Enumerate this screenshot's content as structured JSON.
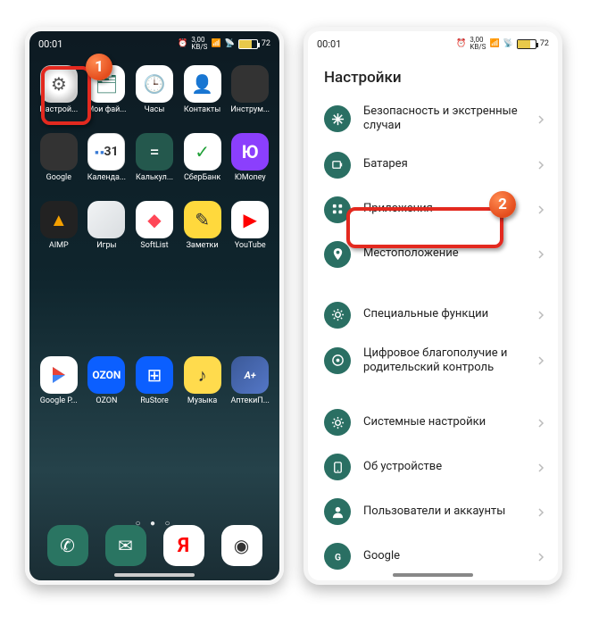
{
  "status": {
    "time": "00:01",
    "speed": "3,00",
    "speed_unit": "KB/S",
    "battery": "72"
  },
  "home": {
    "rows": [
      [
        {
          "label": "Настрой...",
          "icon": "ic-settings",
          "glyph": "⚙"
        },
        {
          "label": "Мои фай...",
          "icon": "ic-files",
          "glyph": "🗂"
        },
        {
          "label": "Часы",
          "icon": "ic-clock",
          "glyph": "🕒"
        },
        {
          "label": "Контакты",
          "icon": "ic-contacts",
          "glyph": "👤"
        },
        {
          "label": "Инструм...",
          "icon": "ic-tools",
          "folder": true
        }
      ],
      [
        {
          "label": "Google",
          "icon": "ic-google",
          "folder": true
        },
        {
          "label": "Календа...",
          "icon": "ic-calendar",
          "calendar": "31"
        },
        {
          "label": "Калькул...",
          "icon": "ic-calc",
          "glyph": "="
        },
        {
          "label": "СберБанк",
          "icon": "ic-sber",
          "glyph": "✓"
        },
        {
          "label": "ЮMoney",
          "icon": "ic-yoo",
          "glyph": "Ю"
        }
      ],
      [
        {
          "label": "AIMP",
          "icon": "ic-aimp",
          "glyph": "▲"
        },
        {
          "label": "Игры",
          "icon": "ic-games",
          "folder": true
        },
        {
          "label": "SoftList",
          "icon": "ic-softlist",
          "glyph": "◆"
        },
        {
          "label": "Заметки",
          "icon": "ic-notes",
          "glyph": "✎"
        },
        {
          "label": "YouTube",
          "icon": "ic-youtube",
          "glyph": "▶"
        }
      ]
    ],
    "favs": [
      {
        "label": "Google P...",
        "icon": "ic-play"
      },
      {
        "label": "OZON",
        "icon": "ic-ozon",
        "glyph": "OZON"
      },
      {
        "label": "RuStore",
        "icon": "ic-rustore",
        "glyph": "⊞"
      },
      {
        "label": "Музыка",
        "icon": "ic-music",
        "glyph": "♪"
      },
      {
        "label": "АптекиП...",
        "icon": "ic-apteka",
        "glyph": "A+"
      }
    ],
    "dock": [
      {
        "icon": "ic-phone",
        "glyph": "✆"
      },
      {
        "icon": "ic-msg",
        "glyph": "✉"
      },
      {
        "icon": "ic-yandex",
        "glyph": "Я"
      },
      {
        "icon": "ic-camera",
        "glyph": "◉"
      }
    ]
  },
  "settings": {
    "title": "Настройки",
    "items": [
      {
        "label": "Безопасность и экстренные случаи",
        "icon": "asterisk"
      },
      {
        "label": "Батарея",
        "icon": "battery"
      },
      {
        "label": "Приложения",
        "icon": "apps"
      },
      {
        "label": "Местоположение",
        "icon": "location"
      },
      {
        "label": "Специальные функции",
        "icon": "gear",
        "gap": true
      },
      {
        "label": "Цифровое благополучие и родительский контроль",
        "icon": "digital"
      },
      {
        "label": "Системные настройки",
        "icon": "gear",
        "gap": true
      },
      {
        "label": "Об устройстве",
        "icon": "device"
      },
      {
        "label": "Пользователи и аккаунты",
        "icon": "user"
      },
      {
        "label": "Google",
        "icon": "google"
      }
    ]
  },
  "callouts": {
    "one": "1",
    "two": "2"
  }
}
